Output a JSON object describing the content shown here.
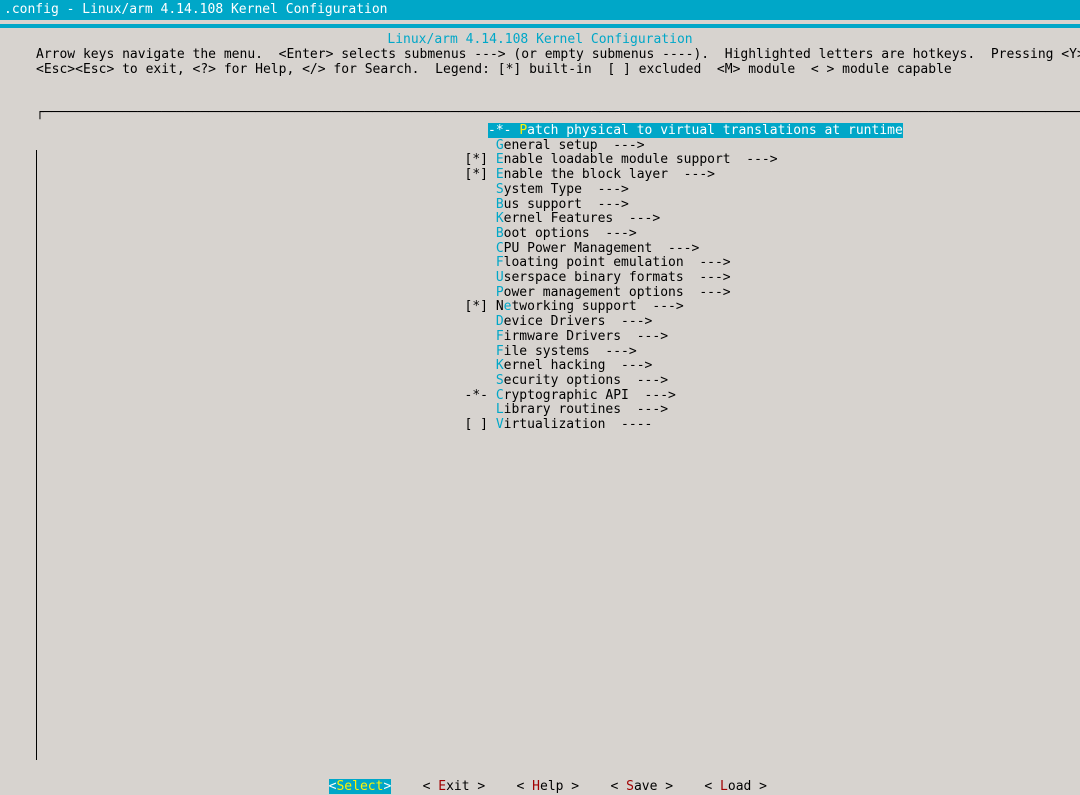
{
  "window_title": ".config - Linux/arm 4.14.108 Kernel Configuration",
  "frame_title": "Linux/arm 4.14.108 Kernel Configuration",
  "help_line1": "Arrow keys navigate the menu.  <Enter> selects submenus ---> (or empty submenus ----).  Highlighted letters are hotkeys.  Pressing <Y> include",
  "help_line2": "<Esc><Esc> to exit, <?> for Help, </> for Search.  Legend: [*] built-in  [ ] excluded  <M> module  < > module capable",
  "menu": [
    {
      "prefix": "-*-",
      "hot": "P",
      "rest": "atch physical to virtual translations at runtime",
      "suffix": "",
      "selected": true
    },
    {
      "prefix": "",
      "hot": "G",
      "rest": "eneral setup  --->",
      "suffix": ""
    },
    {
      "prefix": "[*]",
      "hot": "E",
      "rest": "nable loadable module support  --->",
      "suffix": ""
    },
    {
      "prefix": "[*]",
      "hot": "E",
      "rest": "nable the block layer  --->",
      "suffix": ""
    },
    {
      "prefix": "",
      "hot": "S",
      "rest": "ystem Type  --->",
      "suffix": ""
    },
    {
      "prefix": "",
      "hot": "B",
      "rest": "us support  --->",
      "suffix": ""
    },
    {
      "prefix": "",
      "hot": "K",
      "rest": "ernel Features  --->",
      "suffix": ""
    },
    {
      "prefix": "",
      "hot": "B",
      "rest": "oot options  --->",
      "suffix": ""
    },
    {
      "prefix": "",
      "hot": "C",
      "rest": "PU Power Management  --->",
      "suffix": ""
    },
    {
      "prefix": "",
      "hot": "F",
      "rest": "loating point emulation  --->",
      "suffix": ""
    },
    {
      "prefix": "",
      "hot": "U",
      "rest": "serspace binary formats  --->",
      "suffix": ""
    },
    {
      "prefix": "",
      "hot": "P",
      "rest": "ower management options  --->",
      "suffix": ""
    },
    {
      "prefix": "[*]",
      "hot": "e",
      "rest": "tworking support  --->",
      "pre": "N",
      "suffix": ""
    },
    {
      "prefix": "",
      "hot": "D",
      "rest": "evice Drivers  --->",
      "suffix": ""
    },
    {
      "prefix": "",
      "hot": "F",
      "rest": "irmware Drivers  --->",
      "suffix": ""
    },
    {
      "prefix": "",
      "hot": "F",
      "rest": "ile systems  --->",
      "suffix": ""
    },
    {
      "prefix": "",
      "hot": "K",
      "rest": "ernel hacking  --->",
      "suffix": ""
    },
    {
      "prefix": "",
      "hot": "S",
      "rest": "ecurity options  --->",
      "suffix": ""
    },
    {
      "prefix": "-*-",
      "hot": "C",
      "rest": "ryptographic API  --->",
      "suffix": ""
    },
    {
      "prefix": "",
      "hot": "L",
      "rest": "ibrary routines  --->",
      "suffix": ""
    },
    {
      "prefix": "[ ]",
      "hot": "V",
      "rest": "irtualization  ----",
      "suffix": ""
    }
  ],
  "buttons": {
    "select": "Select",
    "exit": {
      "lb": "< ",
      "hot": "E",
      "rest": "xit >"
    },
    "help": {
      "lb": "< ",
      "hot": "H",
      "rest": "elp >"
    },
    "save": {
      "lb": "< ",
      "hot": "S",
      "rest": "ave >"
    },
    "load": {
      "lb": "< ",
      "hot": "L",
      "rest": "oad >"
    }
  }
}
